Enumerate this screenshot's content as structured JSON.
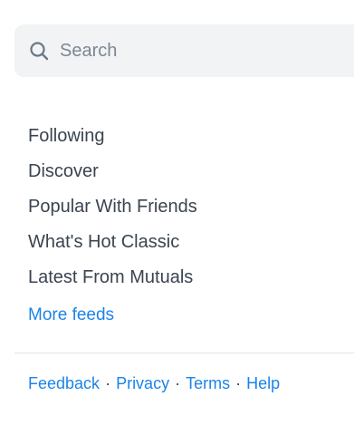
{
  "search": {
    "placeholder": "Search",
    "value": "",
    "icon": "search-icon"
  },
  "feeds": [
    {
      "label": "Following"
    },
    {
      "label": "Discover"
    },
    {
      "label": "Popular With Friends"
    },
    {
      "label": "What's Hot Classic"
    },
    {
      "label": "Latest From Mutuals"
    }
  ],
  "more_feeds_label": "More feeds",
  "footer": {
    "links": [
      {
        "label": "Feedback"
      },
      {
        "label": "Privacy"
      },
      {
        "label": "Terms"
      },
      {
        "label": "Help"
      }
    ],
    "separator": "·"
  },
  "colors": {
    "link": "#1b84e8",
    "text": "#3a4450",
    "search_bg": "#f1f3f5",
    "divider": "#e1e4e8"
  }
}
